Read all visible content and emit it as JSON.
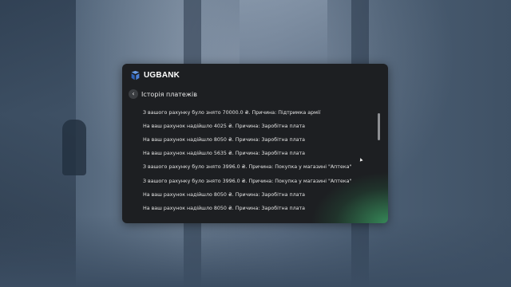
{
  "brand": {
    "name": "UGBANK"
  },
  "header": {
    "back_label": "‹",
    "title": "Історія платежів"
  },
  "transactions": [
    "З вашого рахунку було знято 70000.0 ₴. Причина: Підтримка армії",
    "На ваш рахунок надійшло 4025 ₴. Причина: Заробітна плата",
    "На ваш рахунок надійшло 8050 ₴. Причина: Заробітна плата",
    "На ваш рахунок надійшло 5635 ₴. Причина: Заробітна плата",
    "З вашого рахунку було знято 3996.0 ₴. Причина: Покупка у магазині  \"Аптека\"",
    "З вашого рахунку було знято 3996.0 ₴. Причина: Покупка у магазині  \"Аптека\"",
    "На ваш рахунок надійшло 8050 ₴. Причина: Заробітна плата",
    "На ваш рахунок надійшло 8050 ₴. Причина: Заробітна плата"
  ],
  "colors": {
    "panel": "#1d1f22",
    "accent_green": "#3eaa69",
    "logo_blue": "#4a7fd6"
  }
}
